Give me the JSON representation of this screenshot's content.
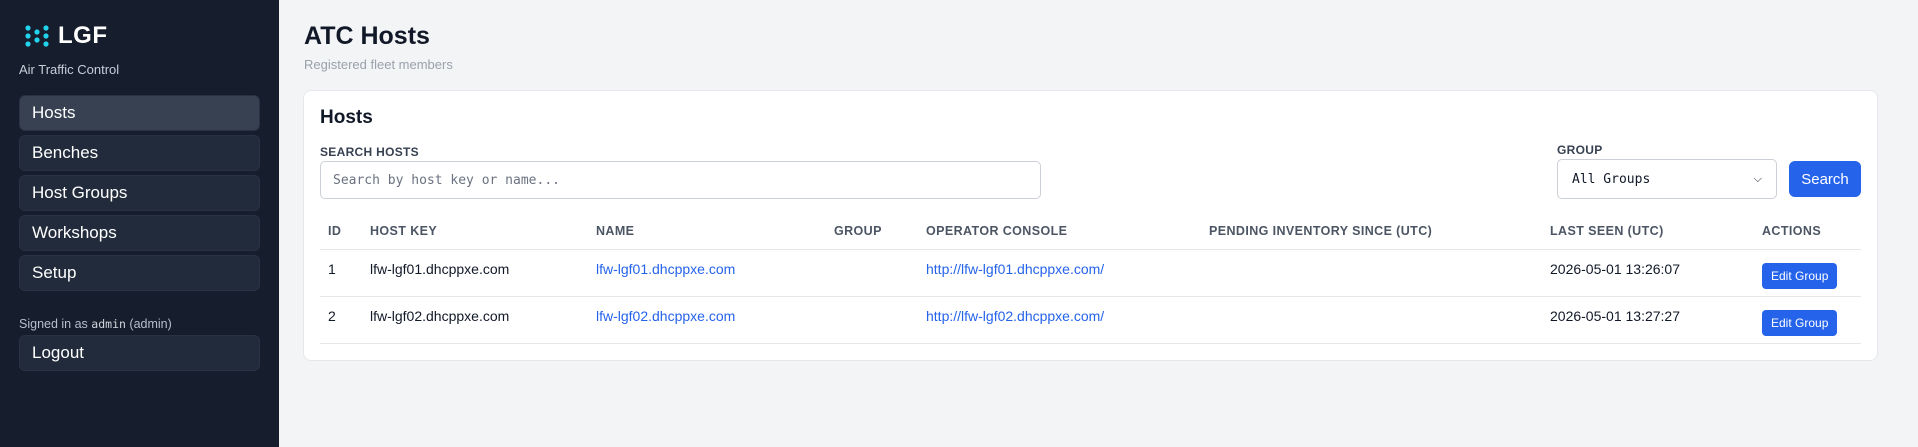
{
  "brand": {
    "name": "LGF",
    "subtitle": "Air Traffic Control",
    "icon": "dots-logo-icon",
    "icon_color": "#22d3ee"
  },
  "nav": [
    {
      "label": "Hosts",
      "active": true
    },
    {
      "label": "Benches"
    },
    {
      "label": "Host Groups"
    },
    {
      "label": "Workshops"
    },
    {
      "label": "Setup"
    }
  ],
  "session": {
    "prefix": "Signed in as",
    "user": "admin",
    "role": "(admin)",
    "logout": "Logout"
  },
  "page": {
    "title": "ATC Hosts",
    "subtitle": "Registered fleet members"
  },
  "card": {
    "title": "Hosts"
  },
  "search": {
    "label": "SEARCH HOSTS",
    "placeholder": "Search by host key or name...",
    "value": ""
  },
  "group_filter": {
    "label": "GROUP",
    "selected": "All Groups"
  },
  "search_button": "Search",
  "table": {
    "columns": [
      "ID",
      "HOST KEY",
      "NAME",
      "GROUP",
      "OPERATOR CONSOLE",
      "PENDING INVENTORY SINCE (UTC)",
      "LAST SEEN (UTC)",
      "ACTIONS"
    ],
    "rows": [
      {
        "id": "1",
        "host_key": "lfw-lgf01.dhcppxe.com",
        "name": "lfw-lgf01.dhcppxe.com",
        "group": "",
        "console": "http://lfw-lgf01.dhcppxe.com/",
        "pending": "",
        "last_seen": "2026-05-01 13:26:07",
        "action": "Edit Group"
      },
      {
        "id": "2",
        "host_key": "lfw-lgf02.dhcppxe.com",
        "name": "lfw-lgf02.dhcppxe.com",
        "group": "",
        "console": "http://lfw-lgf02.dhcppxe.com/",
        "pending": "",
        "last_seen": "2026-05-01 13:27:27",
        "action": "Edit Group"
      }
    ]
  },
  "colors": {
    "sidebar": "#161d2c",
    "accent": "#2563eb",
    "link": "#2563eb"
  }
}
